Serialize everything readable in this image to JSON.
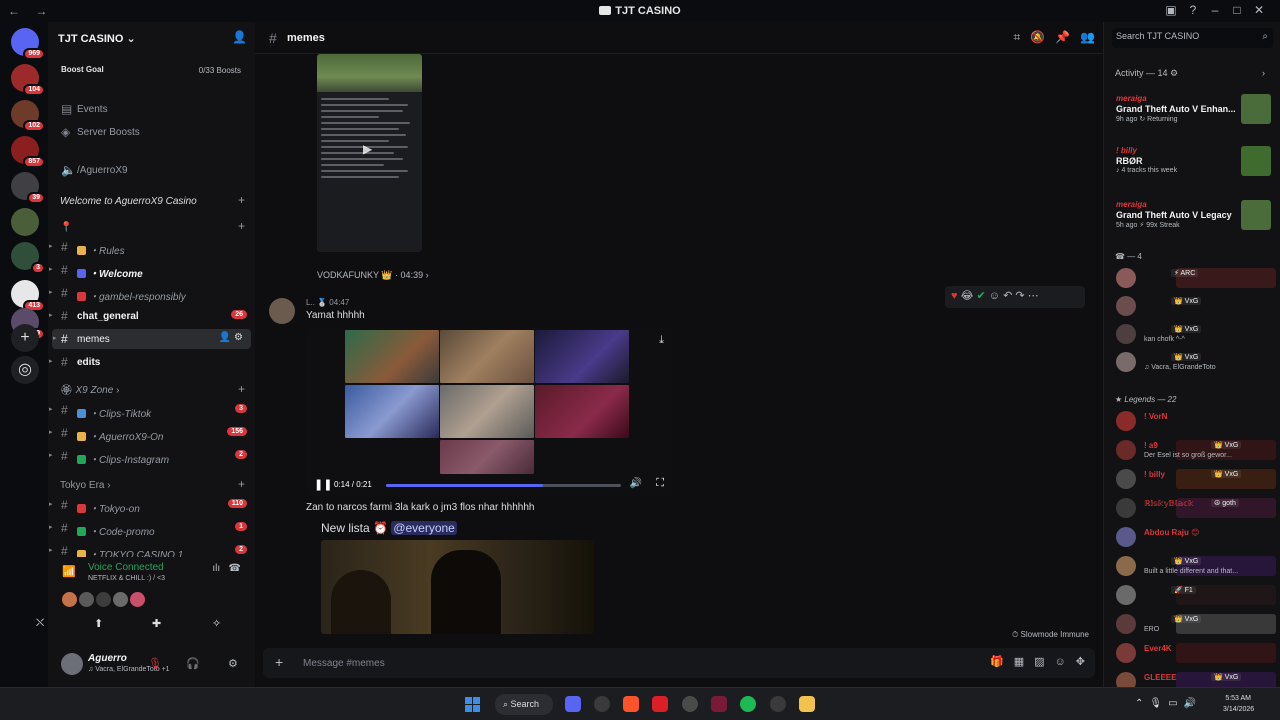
{
  "window": {
    "title": "TJT CASINO",
    "nav": "← →"
  },
  "rail": {
    "servers": [
      {
        "name": "home",
        "badge": "969",
        "color": "#5865f2"
      },
      {
        "name": "server-2",
        "badge": "104",
        "color": "#9d2a2a"
      },
      {
        "name": "server-3",
        "badge": "102",
        "color": "#6e3b2b"
      },
      {
        "name": "server-4",
        "badge": "857",
        "color": "#8b1f1f"
      },
      {
        "name": "server-5",
        "badge": "39",
        "color": "#3f3f44"
      },
      {
        "name": "server-6",
        "badge": "",
        "color": "#4b5e3a"
      },
      {
        "name": "server-7",
        "badge": "3",
        "color": "#2f4f3a"
      },
      {
        "name": "server-8",
        "badge": "413",
        "color": "#e7e7ea"
      },
      {
        "name": "server-9",
        "badge": "119",
        "color": "#5b4b6b"
      }
    ]
  },
  "sidebar": {
    "server_name": "TJT CASINO",
    "boost_label": "Boost Goal",
    "boost_count": "0/33 Boosts",
    "events": "Events",
    "server_boosts": "Server Boosts",
    "voice_top": "/AguerroX9",
    "category_welcome": "Welcome to AguerroX9 Casino",
    "pin_cat": "📍",
    "channels": [
      {
        "label": "・Rules",
        "style": "italic",
        "badge": "",
        "emoji_color": "#e8b34a"
      },
      {
        "label": "・Welcome",
        "style": "bold italic",
        "badge": "",
        "emoji_color": "#5865f2"
      },
      {
        "label": "・gambel-responsibly",
        "style": "",
        "badge": "",
        "emoji_color": "#da373c"
      },
      {
        "label": "chat_general",
        "style": "bold",
        "badge": "26",
        "emoji_color": ""
      },
      {
        "label": "memes",
        "style": "active",
        "badge": "",
        "emoji_color": ""
      },
      {
        "label": "edits",
        "style": "bold",
        "badge": "",
        "emoji_color": ""
      }
    ],
    "category_x9": "X9 Zone",
    "x9_channels": [
      {
        "label": "・Clips-Tiktok",
        "badge": "3",
        "emoji_color": "#4a90d9"
      },
      {
        "label": "・AguerroX9-On",
        "badge": "156",
        "emoji_color": "#e8b34a"
      },
      {
        "label": "・Clips-Instagram",
        "badge": "2",
        "emoji_color": "#23a55a"
      }
    ],
    "category_tokyo": "Tokyo Era",
    "tokyo_channels": [
      {
        "label": "・Tokyo-on",
        "badge": "110",
        "emoji_color": "#da373c"
      },
      {
        "label": "・Code-promo",
        "badge": "1",
        "emoji_color": "#23a55a"
      },
      {
        "label": "・TOKYO CASINO 1",
        "badge": "2",
        "emoji_color": "#e8b34a"
      }
    ],
    "voice": {
      "status": "Voice Connected",
      "channel": "NETFLIX & CHILL :) / <3"
    },
    "user": {
      "name": "Aguerro",
      "status": "♫ Vacra, ElGrandeToto +1"
    }
  },
  "chat": {
    "channel": "memes",
    "reply_user": "VODKAFUNKY 👑 · 04:39 ›",
    "msg_meta": "L.. 🥈 04:47",
    "msg_text": "Yamat hhhhh",
    "video_time": "0:14 / 0:21",
    "video_progress": 0.67,
    "line2": "Zan to narcos farmi 3la kark o jm3 flos nhar hhhhhh",
    "line3_prefix": "New lista ⏰",
    "mention": "@everyone",
    "slowmode": "Slowmode Immune",
    "composer_placeholder": "Message #memes"
  },
  "members": {
    "search_placeholder": "Search TJT CASINO",
    "activity_header": "Activity — 14",
    "activities": [
      {
        "user": "meraiga",
        "game": "Grand Theft Auto V Enhan...",
        "sub": "9h ago  ↻ Returning",
        "color": "#4a6b3a"
      },
      {
        "user": "! billy",
        "game": "RBØR",
        "sub": "♪ 4 tracks this week",
        "color": "#3f6b2f"
      },
      {
        "user": "meraiga",
        "game": "Grand Theft Auto V Legacy",
        "sub": "5h ago  ⚡ 99x Streak",
        "color": "#4a6b3a"
      }
    ],
    "group1": "— 4",
    "group1_members": [
      {
        "name": "",
        "tag": "⚡ ARC",
        "status": "",
        "color": "#da373c",
        "avatar": "#8a5a5a",
        "bg": "#5a1f1f"
      },
      {
        "name": "",
        "tag": "👑 VxG",
        "status": "",
        "color": "#f2f3f5",
        "avatar": "#6b4d4d",
        "bg": ""
      },
      {
        "name": "",
        "tag": "👑 VxG",
        "status": "kan chofk ^-^",
        "color": "#f2f3f5",
        "avatar": "#4d3f3f",
        "bg": ""
      },
      {
        "name": "",
        "tag": "👑 VxG",
        "status": "♫ Vacra, ElGrandeToto",
        "color": "#f2f3f5",
        "avatar": "#7a6b6b",
        "bg": ""
      }
    ],
    "group2": "Legends — 22",
    "group2_members": [
      {
        "name": "! VorN",
        "tag": "",
        "status": "",
        "color": "#da373c",
        "avatar": "#8a2a2a",
        "bg": ""
      },
      {
        "name": "! a9",
        "tag": "👑 VxG",
        "status": "Der Esel ist so groß gewor...",
        "color": "#da373c",
        "avatar": "#6b2a2a",
        "bg": "#4a1515"
      },
      {
        "name": "! billy",
        "tag": "👑 VxG",
        "status": "",
        "color": "#da373c",
        "avatar": "#4a4a4a",
        "bg": "#5a2a10"
      },
      {
        "name": "ℝ𝕚𝕤𝕜𝕪𝔹𝕝𝕒𝕔𝕜",
        "tag": "☮ goth",
        "status": "",
        "color": "#da373c",
        "avatar": "#3a3a3a",
        "bg": "#4a1a3a"
      },
      {
        "name": "Abdou Raju 😊",
        "tag": "",
        "status": "",
        "color": "#da373c",
        "avatar": "#5a5a8a",
        "bg": ""
      },
      {
        "name": "",
        "tag": "👑 VxG",
        "status": "Built a little different and that...",
        "color": "#da373c",
        "avatar": "#8a6a4a",
        "bg": "#3a1a5a"
      },
      {
        "name": "",
        "tag": "🚀 F1",
        "status": "",
        "color": "#da373c",
        "avatar": "#6a6a6a",
        "bg": "#2a1a1a"
      },
      {
        "name": "",
        "tag": "👑 VxG",
        "status": "ERO",
        "color": "#da373c",
        "avatar": "#5a3a3a",
        "bg": "#5a5a5a"
      },
      {
        "name": "Ever4K",
        "tag": "",
        "status": "",
        "color": "#da373c",
        "avatar": "#7a3a3a",
        "bg": "#4a1515"
      },
      {
        "name": "GLEEEE",
        "tag": "👑 VxG",
        "status": "",
        "color": "#da373c",
        "avatar": "#7a4a3a",
        "bg": "#3a1a5a"
      }
    ]
  },
  "taskbar": {
    "search": "Search",
    "time": "5:53 AM",
    "date": "3/14/2026"
  }
}
